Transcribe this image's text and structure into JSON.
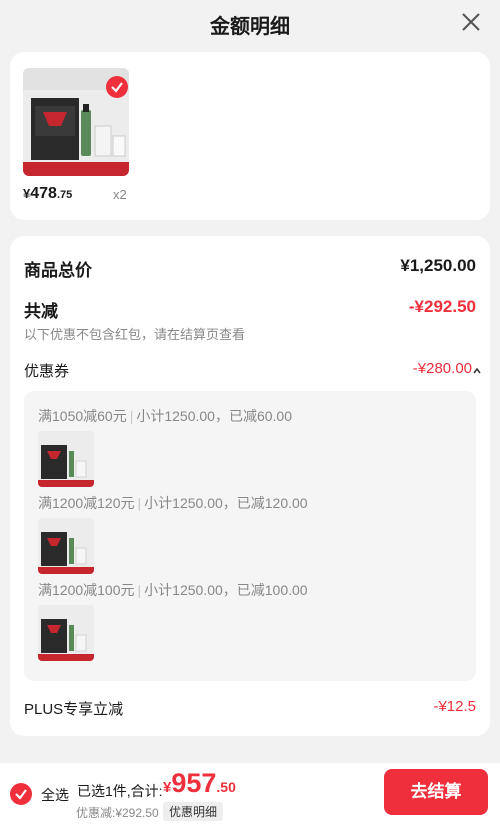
{
  "header": {
    "title": "金额明细"
  },
  "product": {
    "price_symbol": "¥",
    "price_int": "478",
    "price_dec": ".75",
    "quantity": "x2"
  },
  "summary": {
    "goods_total_label": "商品总价",
    "goods_total_value": "¥1,250.00",
    "total_reduce_label": "共减",
    "total_reduce_value": "-¥292.50",
    "reduce_note": "以下优惠不包含红包，请在结算页查看",
    "coupon_label": "优惠券",
    "coupon_value": "-¥280.00",
    "coupons": [
      {
        "rule": "满1050减60元",
        "detail": "小计1250.00，已减60.00"
      },
      {
        "rule": "满1200减120元",
        "detail": "小计1250.00，已减120.00"
      },
      {
        "rule": "满1200减100元",
        "detail": "小计1250.00，已减100.00"
      }
    ],
    "plus_label": "PLUS专享立减",
    "plus_value": "-¥12.5"
  },
  "footer": {
    "select_all": "全选",
    "selected_info": "已选1件,合计:",
    "total_symbol": "¥",
    "total_int": "957",
    "total_dec": ".50",
    "discount_text": "优惠减:¥292.50",
    "detail_link": "优惠明细",
    "checkout": "去结算"
  },
  "colors": {
    "accent": "#ef2f3b",
    "background": "#f2f2f2"
  }
}
